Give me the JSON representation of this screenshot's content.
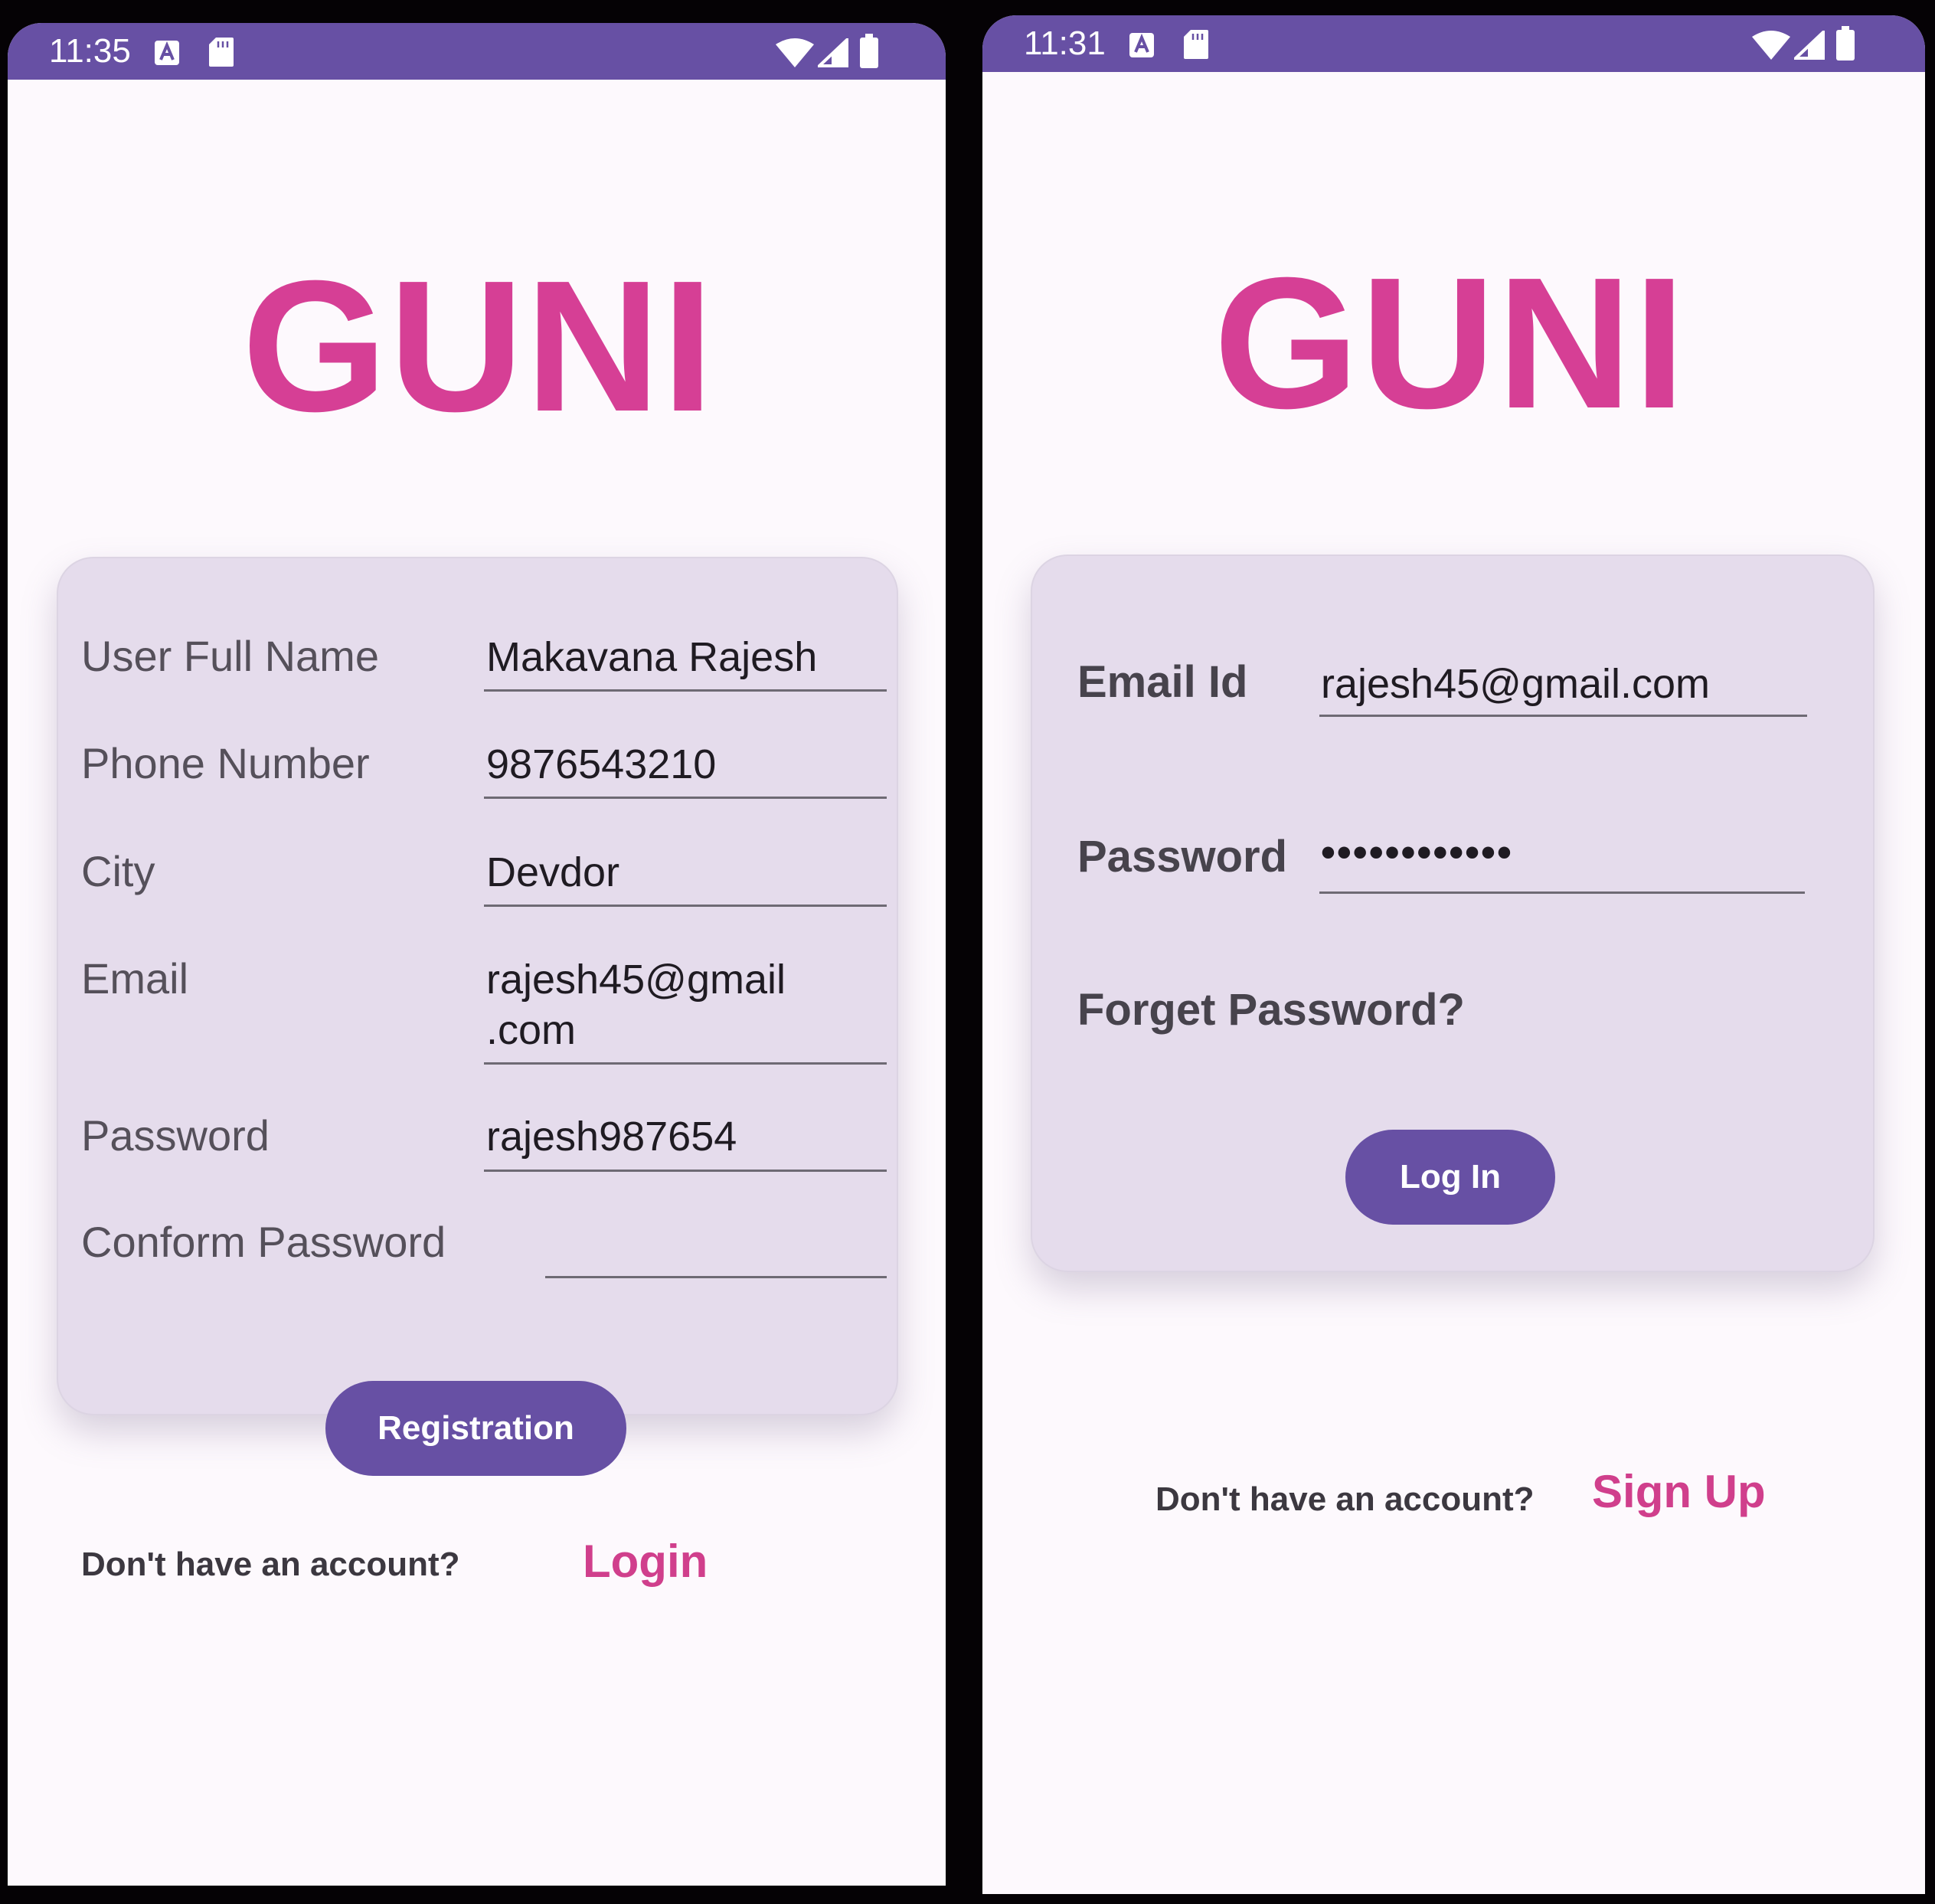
{
  "registration_screen": {
    "status_bar": {
      "time": "11:35",
      "icons": [
        "notification-a-icon",
        "sd-card-icon",
        "wifi-icon",
        "signal-icon",
        "battery-icon"
      ]
    },
    "logo": "GUNI",
    "form": {
      "fields": [
        {
          "label": "User Full Name",
          "value": "Makavana Rajesh"
        },
        {
          "label": "Phone Number",
          "value": "9876543210"
        },
        {
          "label": "City",
          "value": "Devdor"
        },
        {
          "label": "Email",
          "value": "rajesh45@gmail\n.com"
        },
        {
          "label": "Password",
          "value": "rajesh987654"
        },
        {
          "label": "Conform Password",
          "value": ""
        }
      ],
      "submit_label": "Registration"
    },
    "footer": {
      "prompt": "Don't have an account?",
      "link_label": "Login"
    }
  },
  "login_screen": {
    "status_bar": {
      "time": "11:31",
      "icons": [
        "notification-a-icon",
        "sd-card-icon",
        "wifi-icon",
        "signal-icon",
        "battery-icon"
      ]
    },
    "logo": "GUNI",
    "form": {
      "email_label": "Email Id",
      "email_value": "rajesh45@gmail.com",
      "password_label": "Password",
      "password_value": "••••••••••••",
      "forgot_label": "Forget Password?",
      "submit_label": "Log In"
    },
    "footer": {
      "prompt": "Don't have an account?",
      "link_label": "Sign Up"
    }
  },
  "colors": {
    "primary": "#6750a4",
    "brand_pink": "#d63f95",
    "card_background": "#e5dcec",
    "page_background": "#fdf9fd"
  }
}
